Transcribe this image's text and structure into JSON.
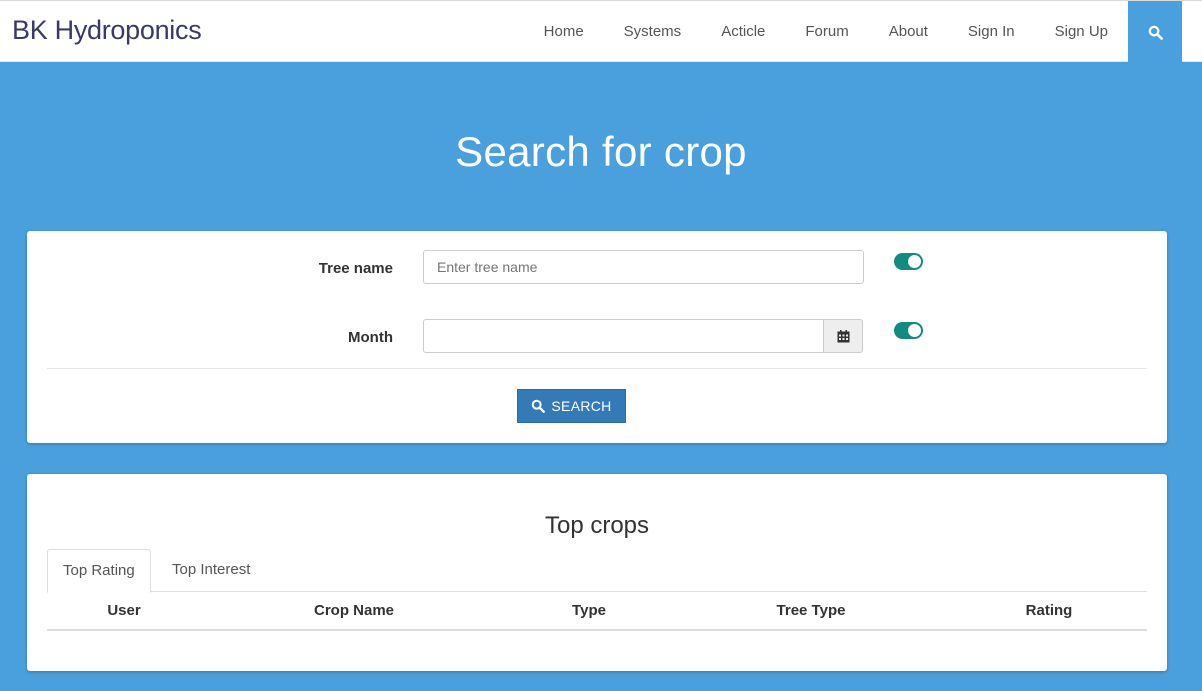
{
  "brand": "BK Hydroponics",
  "nav": [
    "Home",
    "Systems",
    "Acticle",
    "Forum",
    "About",
    "Sign In",
    "Sign Up"
  ],
  "nav_search_icon": "search-icon",
  "hero": {
    "title": "Search for crop"
  },
  "search_form": {
    "tree_name_label": "Tree name",
    "tree_name_placeholder": "Enter tree name",
    "tree_name_value": "",
    "month_label": "Month",
    "month_value": "",
    "calendar_icon": "calendar-icon",
    "tree_name_toggle_on": true,
    "month_toggle_on": true,
    "submit_label": "SEARCH"
  },
  "top_crops": {
    "title": "Top crops",
    "tabs": [
      "Top Rating",
      "Top Interest"
    ],
    "active_tab": "Top Rating",
    "columns": [
      "User",
      "Crop Name",
      "Type",
      "Tree Type",
      "Rating"
    ],
    "rows": []
  },
  "colors": {
    "background": "#4aa0dc",
    "brand_text": "#3b3a66",
    "toggle": "#128c7e",
    "primary_button": "#337ab7"
  }
}
